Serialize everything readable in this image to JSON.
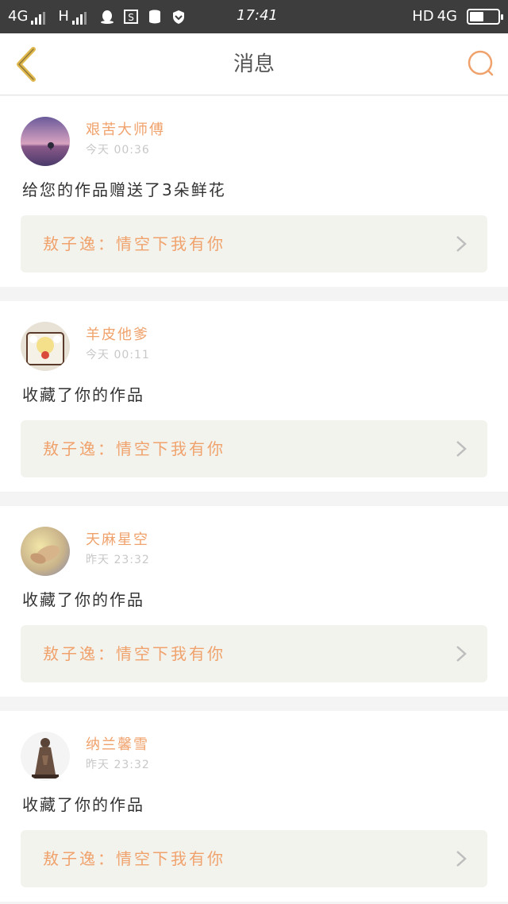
{
  "status_bar": {
    "network1": "4G",
    "network2": "H",
    "time": "17:41",
    "hd": "HD",
    "network3": "4G",
    "battery_level": 0.5
  },
  "header": {
    "title": "消息"
  },
  "messages": [
    {
      "username": "艰苦大师傅",
      "time": "今天  00:36",
      "text": "给您的作品赠送了3朵鲜花",
      "work": "敖子逸：情空下我有你"
    },
    {
      "username": "羊皮他爹",
      "time": "今天  00:11",
      "text": "收藏了你的作品",
      "work": "敖子逸：情空下我有你"
    },
    {
      "username": "天麻星空",
      "time": "昨天  23:32",
      "text": "收藏了你的作品",
      "work": "敖子逸：情空下我有你"
    },
    {
      "username": "纳兰馨雪",
      "time": "昨天  23:32",
      "text": "收藏了你的作品",
      "work": "敖子逸：情空下我有你"
    }
  ],
  "colors": {
    "accent": "#f0a26c",
    "back_icon": "#e0b94e",
    "status_bar_bg": "#3d3d3d"
  },
  "icons": {
    "back": "chevron-left-icon",
    "search": "search-icon",
    "row_arrow": "chevron-right-icon"
  }
}
